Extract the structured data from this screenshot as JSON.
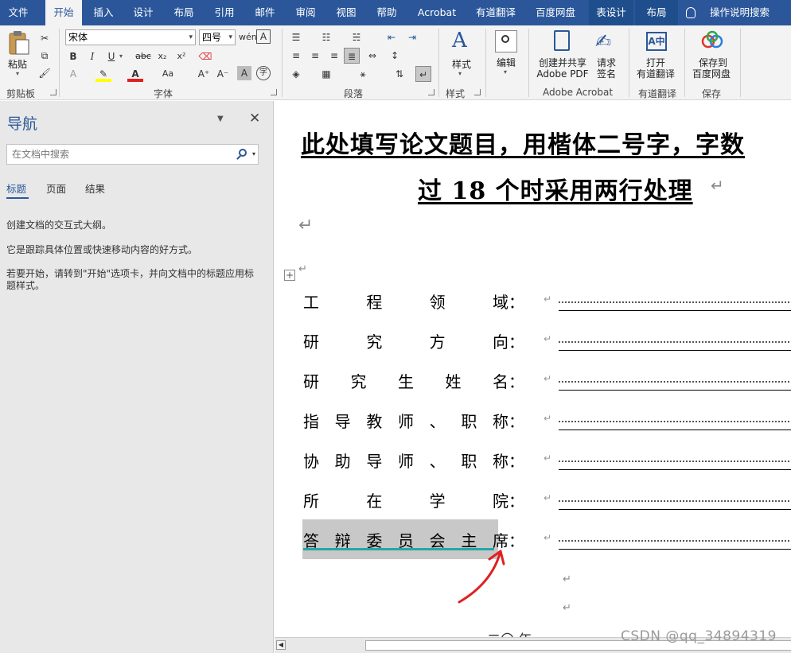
{
  "tabs": [
    "文件",
    "开始",
    "插入",
    "设计",
    "布局",
    "引用",
    "邮件",
    "审阅",
    "视图",
    "帮助",
    "Acrobat",
    "有道翻译",
    "百度网盘",
    "表设计",
    "布局"
  ],
  "tell_me": "操作说明搜索",
  "ribbon": {
    "paste_label": "粘贴",
    "clipboard_group": "剪贴板",
    "font_name": "宋体",
    "font_size": "四号",
    "font_group": "字体",
    "paragraph_group": "段落",
    "styles_label": "样式",
    "styles_group": "样式",
    "edit_label": "编辑",
    "create_pdf_l1": "创建并共享",
    "create_pdf_l2": "Adobe PDF",
    "request_sign_l1": "请求",
    "request_sign_l2": "签名",
    "acrobat_group": "Adobe Acrobat",
    "youdao_l1": "打开",
    "youdao_l2": "有道翻译",
    "youdao_group": "有道翻译",
    "baidu_l1": "保存到",
    "baidu_l2": "百度网盘",
    "save_group": "保存"
  },
  "nav": {
    "title": "导航",
    "search_placeholder": "在文档中搜索",
    "tabs": [
      "标题",
      "页面",
      "结果"
    ],
    "text1": "创建文档的交互式大纲。",
    "text2": "它是跟踪具体位置或快速移动内容的好方式。",
    "text3": "若要开始，请转到\"开始\"选项卡，并向文档中的标题应用标题样式。"
  },
  "doc": {
    "title_line1": "此处填写论文题目，用楷体二号字，字数",
    "title_line2": "过 18 个时采用两行处理",
    "fields": [
      "工程领域",
      "研究方向",
      "研究生姓名",
      "指导教师、职称",
      "协助导师、职称",
      "所在学院",
      "答辩委员会主席"
    ],
    "colon": "：",
    "para_mark": "↵",
    "footer_partial": "二〇    年"
  },
  "watermark": "CSDN @qq_34894319",
  "accent": "#2b579a",
  "selection_color": "#c8c8c8",
  "annotation_color": "#e02020"
}
